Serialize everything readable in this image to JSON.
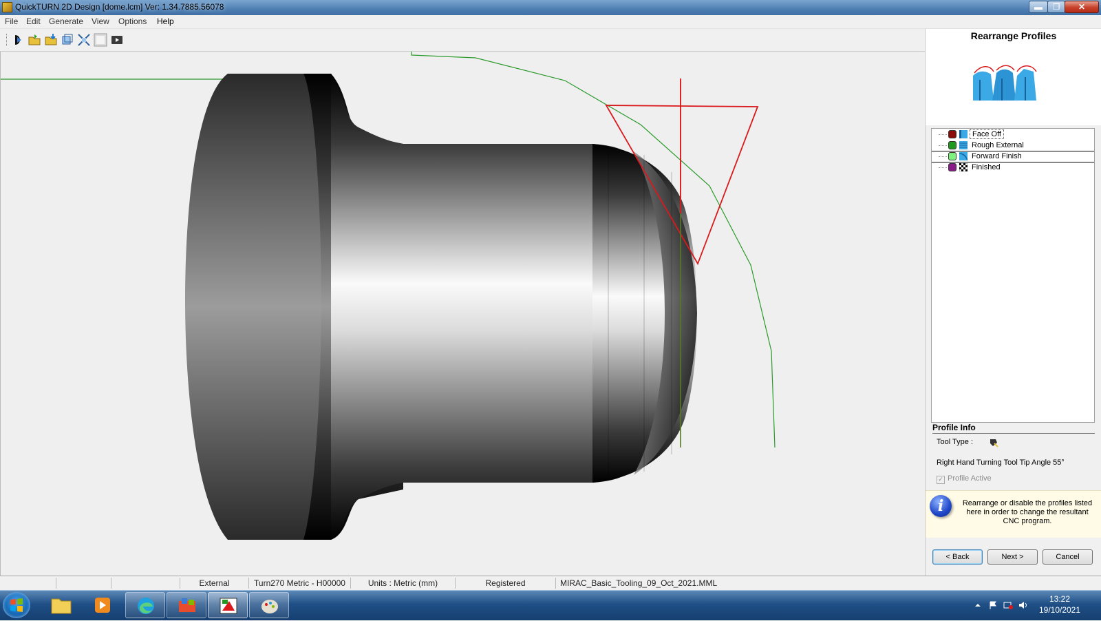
{
  "window": {
    "title": "QuickTURN 2D Design [dome.lcm] Ver: 1.34.7885.56078",
    "min_glyph": "▬",
    "max_glyph": "❐",
    "close_glyph": "✕"
  },
  "menu": {
    "file": "File",
    "edit": "Edit",
    "generate": "Generate",
    "view": "View",
    "options": "Options",
    "help": "Help"
  },
  "toolbar": {
    "icons": [
      "run-simulation-icon",
      "open-file-icon",
      "save-file-icon",
      "3d-view-icon",
      "fit-view-icon",
      "stop-icon",
      "play-icon"
    ]
  },
  "panel": {
    "title": "Rearrange Profiles",
    "profiles": [
      {
        "label": "Face Off",
        "color": "#8b0a0a",
        "selected": true
      },
      {
        "label": "Rough External",
        "color": "#1f9a1f",
        "selected": false
      },
      {
        "label": "Forward Finish",
        "color": "#7ef07e",
        "selected": false
      },
      {
        "label": "Finished",
        "color": "#8a1c8a",
        "selected": false
      }
    ],
    "profile_info_title": "Profile Info",
    "tool_type_label": "Tool Type :",
    "tool_description": "Right Hand Turning Tool Tip Angle 55°",
    "profile_active_label": "Profile Active",
    "profile_active_checked": true,
    "info_glyph": "i",
    "info_text": "Rearrange or disable the profiles listed here in order to change the resultant CNC program.",
    "back_label": "< Back",
    "next_label": "Next >",
    "cancel_label": "Cancel"
  },
  "status": {
    "mode": "External",
    "machine": "Turn270 Metric - H00000",
    "units": "Units : Metric (mm)",
    "license": "Registered",
    "tooling_file": "MIRAC_Basic_Tooling_09_Oct_2021.MML"
  },
  "taskbar": {
    "time": "13:22",
    "date": "19/10/2021"
  }
}
